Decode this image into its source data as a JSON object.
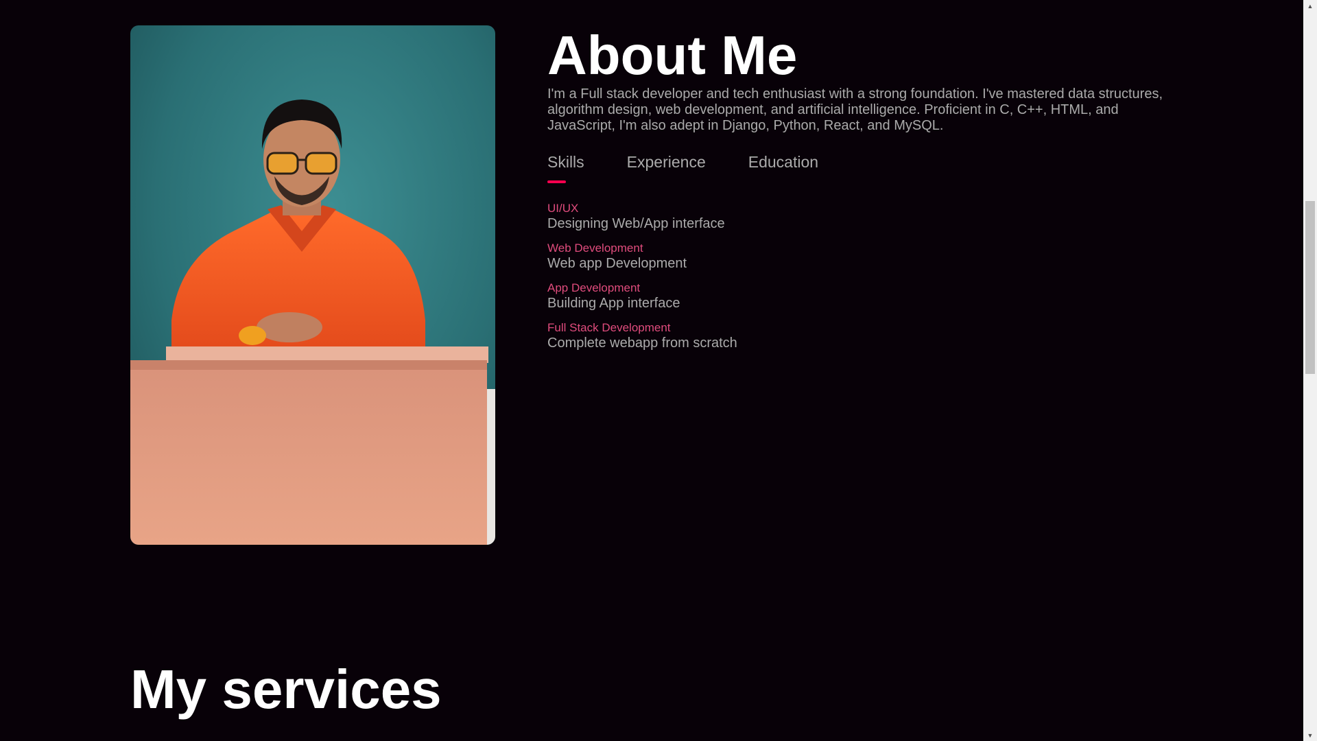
{
  "about": {
    "heading": "About Me",
    "bio": "I'm a Full stack developer and tech enthusiast with a strong foundation. I've mastered data structures, algorithm design, web development, and artificial intelligence. Proficient in C, C++, HTML, and JavaScript, I'm also adept in Django, Python, React, and MySQL.",
    "tabs": [
      {
        "label": "Skills",
        "active": true
      },
      {
        "label": "Experience",
        "active": false
      },
      {
        "label": "Education",
        "active": false
      }
    ],
    "skills": [
      {
        "title": "UI/UX",
        "desc": "Designing Web/App interface"
      },
      {
        "title": "Web Development",
        "desc": "Web app Development"
      },
      {
        "title": "App Development",
        "desc": "Building App interface"
      },
      {
        "title": "Full Stack Development",
        "desc": "Complete webapp from scratch"
      }
    ]
  },
  "services": {
    "heading": "My services"
  },
  "colors": {
    "background": "#080108",
    "accent": "#ff004f",
    "skill_title": "#e04c7d",
    "text": "#ababab",
    "heading": "#ffffff"
  },
  "icons": {
    "scroll_up": "chevron-up-icon",
    "scroll_down": "chevron-down-icon"
  }
}
